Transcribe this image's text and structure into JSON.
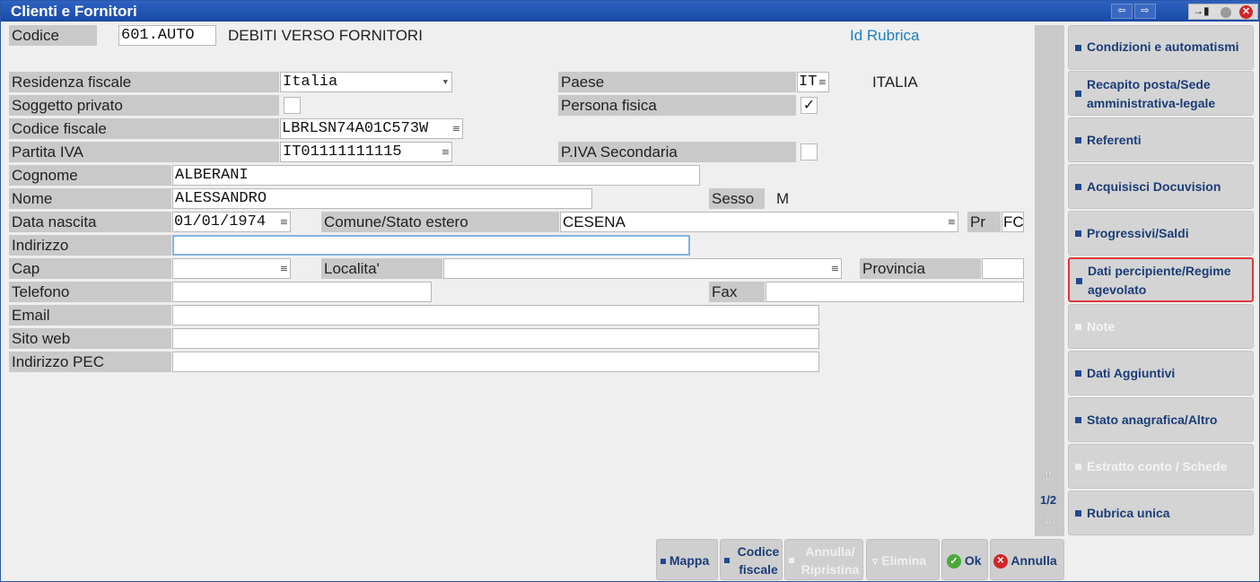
{
  "window": {
    "title": "Clienti e Fornitori"
  },
  "header": {
    "codice_label": "Codice",
    "codice_value": "601.AUTO",
    "descrizione": "DEBITI VERSO FORNITORI",
    "id_rubrica": "Id Rubrica"
  },
  "form": {
    "residenza_label": "Residenza fiscale",
    "residenza_value": "Italia",
    "paese_label": "Paese",
    "paese_code": "IT",
    "paese_name": "ITALIA",
    "soggetto_privato_label": "Soggetto privato",
    "soggetto_privato_checked": false,
    "persona_fisica_label": "Persona fisica",
    "persona_fisica_mark": "✓",
    "codice_fiscale_label": "Codice fiscale",
    "codice_fiscale_value": "LBRLSN74A01C573W",
    "partita_iva_label": "Partita IVA",
    "partita_iva_value": "IT01111111115",
    "piva_secondaria_label": "P.IVA Secondaria",
    "cognome_label": "Cognome",
    "cognome_value": "ALBERANI",
    "nome_label": "Nome",
    "nome_value": "ALESSANDRO",
    "sesso_label": "Sesso",
    "sesso_value": "M",
    "data_nascita_label": "Data nascita",
    "data_nascita_value": "01/01/1974",
    "comune_label": "Comune/Stato estero",
    "comune_value": "CESENA",
    "pr_label": "Pr",
    "pr_value": "FC",
    "indirizzo_label": "Indirizzo",
    "indirizzo_value": "",
    "cap_label": "Cap",
    "cap_value": "",
    "localita_label": "Localita'",
    "localita_value": "",
    "provincia_label": "Provincia",
    "provincia_value": "",
    "telefono_label": "Telefono",
    "telefono_value": "",
    "fax_label": "Fax",
    "fax_value": "",
    "email_label": "Email",
    "email_value": "",
    "sito_web_label": "Sito web",
    "sito_web_value": "",
    "pec_label": "Indirizzo PEC",
    "pec_value": ""
  },
  "pager": {
    "page": "1/2"
  },
  "side_buttons": [
    {
      "label": "Condizioni e automatismi",
      "enabled": true
    },
    {
      "label": "Recapito posta/Sede amministrativa-legale",
      "enabled": true
    },
    {
      "label": "Referenti",
      "enabled": true
    },
    {
      "label": "Acquisisci Docuvision",
      "enabled": true
    },
    {
      "label": "Progressivi/Saldi",
      "enabled": true
    },
    {
      "label": "Dati percipiente/Regime agevolato",
      "enabled": true,
      "highlighted": true
    },
    {
      "label": "Note",
      "enabled": false
    },
    {
      "label": "Dati Aggiuntivi",
      "enabled": true
    },
    {
      "label": "Stato anagrafica/Altro",
      "enabled": true
    },
    {
      "label": "Estratto conto / Schede",
      "enabled": false
    },
    {
      "label": "Rubrica unica",
      "enabled": true
    }
  ],
  "bottom_buttons": {
    "mappa": "Mappa",
    "codice_fiscale_1": "Codice",
    "codice_fiscale_2": "fiscale",
    "annulla_ripristina_1": "Annulla/",
    "annulla_ripristina_2": "Ripristina",
    "elimina": "Elimina",
    "ok": "Ok",
    "annulla": "Annulla"
  },
  "colors": {
    "titlebar": "#1f50ad",
    "accent": "#1b3d78",
    "highlight_border": "#e0383b",
    "link": "#1a7fc4"
  }
}
